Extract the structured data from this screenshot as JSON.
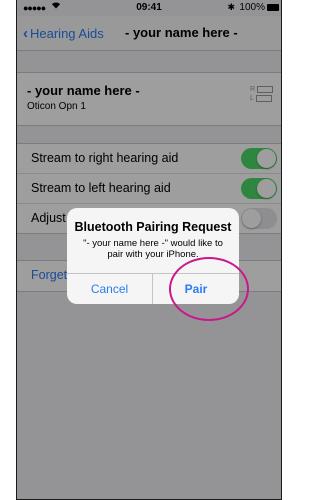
{
  "status_bar": {
    "signal": "●●●●●",
    "wifi_icon": "wifi-icon",
    "time": "09:41",
    "bluetooth_icon": "bluetooth-icon",
    "battery_pct": "100%"
  },
  "nav": {
    "back_label": "Hearing Aids",
    "title": "- your name here -"
  },
  "device": {
    "name": "- your name here -",
    "model": "Oticon Opn 1",
    "battery_right": "R",
    "battery_left": "L"
  },
  "settings": {
    "rows": [
      {
        "label": "Stream to right hearing aid",
        "on": true
      },
      {
        "label": "Stream to left hearing aid",
        "on": true
      },
      {
        "label": "Adjust",
        "on": false
      }
    ],
    "forget_label": "Forget"
  },
  "alert": {
    "title": "Bluetooth Pairing Request",
    "message": "\"- your name here -\" would like to pair with your iPhone.",
    "cancel_label": "Cancel",
    "pair_label": "Pair"
  },
  "colors": {
    "ios_blue": "#2a7cf6",
    "toggle_on": "#4cd964",
    "highlight": "#c8188b"
  }
}
